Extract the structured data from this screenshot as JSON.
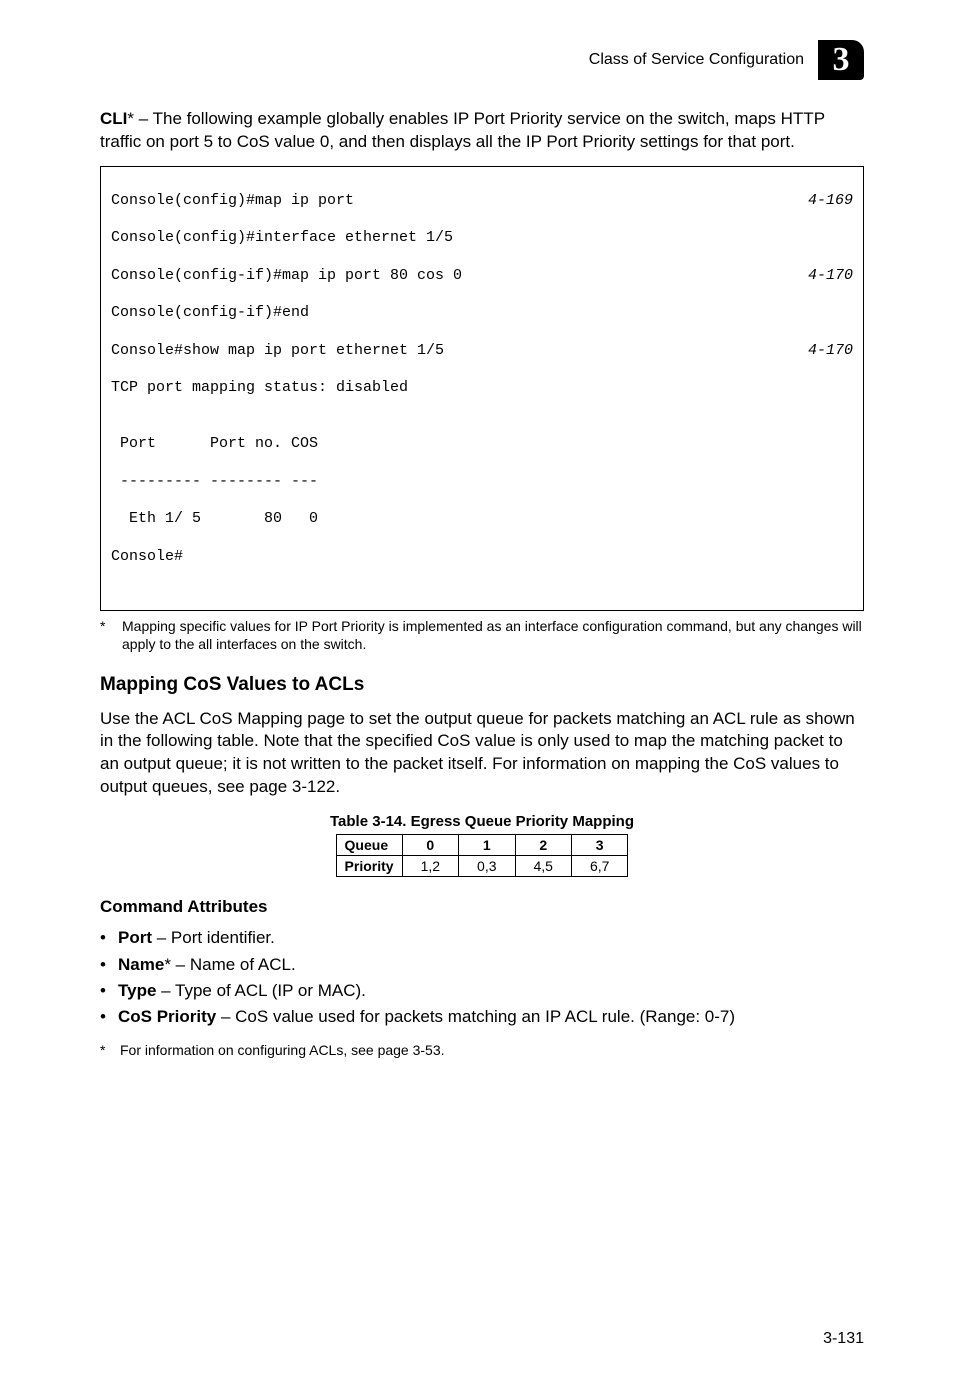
{
  "header": {
    "running_title": "Class of Service Configuration",
    "chapter_number": "3"
  },
  "intro": {
    "cli_label": "CLI",
    "cli_star": "*",
    "text_rest": " – The following example globally enables IP Port Priority service on the switch, maps HTTP traffic on port 5 to CoS value 0, and then displays all the IP Port Priority settings for that port."
  },
  "code": {
    "l1": "Console(config)#map ip port",
    "r1": "4-169",
    "l2": "Console(config)#interface ethernet 1/5",
    "l3": "Console(config-if)#map ip port 80 cos 0",
    "r3": "4-170",
    "l4": "Console(config-if)#end",
    "l5": "Console#show map ip port ethernet 1/5",
    "r5": "4-170",
    "l6": "TCP port mapping status: disabled",
    "l7": "",
    "l8": " Port      Port no. COS",
    "l9": " --------- -------- ---",
    "l10": "  Eth 1/ 5       80   0",
    "l11": "Console#"
  },
  "code_footnote": {
    "star": "*",
    "text": "Mapping specific values for IP Port Priority is implemented as an interface configuration command, but any changes will apply to the all interfaces on the switch."
  },
  "section_heading": "Mapping CoS Values to ACLs",
  "section_para": "Use the ACL CoS Mapping page to set the output queue for packets matching an ACL rule as shown in the following table. Note that the specified CoS value is only used to map the matching packet to an output queue; it is not written to the packet itself. For information on mapping the CoS values to output queues, see page 3-122.",
  "table_caption": {
    "label": "Table 3-14.",
    "title": "Egress Queue Priority Mapping"
  },
  "chart_data": {
    "type": "table",
    "title": "Egress Queue Priority Mapping",
    "columns": [
      "Queue",
      "0",
      "1",
      "2",
      "3"
    ],
    "rows": [
      {
        "label": "Priority",
        "values": [
          "1,2",
          "0,3",
          "4,5",
          "6,7"
        ]
      }
    ]
  },
  "cmd_attr_heading": "Command Attributes",
  "bullets": [
    {
      "label": "Port",
      "rest": " – Port identifier."
    },
    {
      "label": "Name",
      "star": "*",
      "rest": " – Name of ACL."
    },
    {
      "label": "Type",
      "rest": " – Type of ACL (IP or MAC)."
    },
    {
      "label": "CoS Priority",
      "rest": " – CoS value used for packets matching an IP ACL rule. (Range: 0-7)"
    }
  ],
  "acl_footnote": {
    "star": "*",
    "text": "For information on configuring ACLs, see page 3-53."
  },
  "page_number": "3-131"
}
